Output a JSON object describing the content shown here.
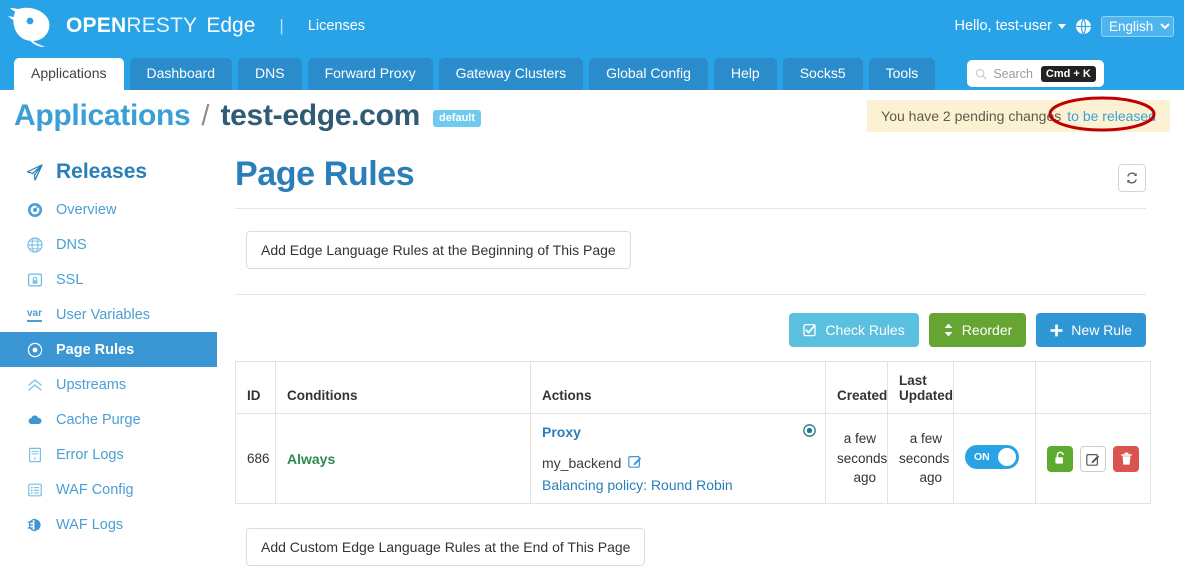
{
  "topbar": {
    "brand_open": "OPEN",
    "brand_resty": "RESTY",
    "brand_product": "Edge",
    "divider": "|",
    "licenses_label": "Licenses",
    "user_greeting": "Hello, test-user",
    "language_selected": "English",
    "language_options": [
      "English"
    ],
    "accent_color": "#29a3e8"
  },
  "nav": {
    "tabs": [
      {
        "label": "Applications",
        "active": true
      },
      {
        "label": "Dashboard",
        "active": false
      },
      {
        "label": "DNS",
        "active": false
      },
      {
        "label": "Forward Proxy",
        "active": false
      },
      {
        "label": "Gateway Clusters",
        "active": false
      },
      {
        "label": "Global Config",
        "active": false
      },
      {
        "label": "Help",
        "active": false
      },
      {
        "label": "Socks5",
        "active": false
      },
      {
        "label": "Tools",
        "active": false
      }
    ],
    "search": {
      "placeholder": "Search",
      "shortcut": "Cmd + K"
    }
  },
  "breadcrumb": {
    "root": "Applications",
    "separator": "/",
    "current": "test-edge.com",
    "badge": "default"
  },
  "pending": {
    "text": "You have 2 pending changes",
    "link_label": "to be released",
    "count": 2,
    "annotation_color": "#c00000",
    "banner_color": "#fcf2d3"
  },
  "sidebar": {
    "title": "Releases",
    "items": [
      {
        "label": "Overview",
        "icon": "gauge-icon",
        "active": false
      },
      {
        "label": "DNS",
        "icon": "globe-icon",
        "active": false
      },
      {
        "label": "SSL",
        "icon": "certificate-lock-icon",
        "active": false
      },
      {
        "label": "User Variables",
        "icon": "var-icon",
        "active": false
      },
      {
        "label": "Page Rules",
        "icon": "target-icon",
        "active": true
      },
      {
        "label": "Upstreams",
        "icon": "chevrons-up-icon",
        "active": false
      },
      {
        "label": "Cache Purge",
        "icon": "cloud-icon",
        "active": false
      },
      {
        "label": "Error Logs",
        "icon": "document-x-icon",
        "active": false
      },
      {
        "label": "WAF Config",
        "icon": "list-icon",
        "active": false
      },
      {
        "label": "WAF Logs",
        "icon": "waf-log-icon",
        "active": false
      }
    ]
  },
  "main": {
    "title": "Page Rules",
    "refresh_icon": "refresh-icon",
    "add_top_label": "Add Edge Language Rules at the Beginning of This Page",
    "add_bottom_label": "Add Custom Edge Language Rules at the End of This Page",
    "actions": {
      "check_rules": "Check Rules",
      "reorder": "Reorder",
      "new_rule": "New Rule",
      "check_color": "#5bc0de",
      "reorder_color": "#67a532",
      "new_color": "#2f97d6"
    },
    "table": {
      "columns": [
        "ID",
        "Conditions",
        "Actions",
        "Created",
        "Last Updated",
        "",
        ""
      ],
      "rows": [
        {
          "id": "686",
          "condition": "Always",
          "action_title": "Proxy",
          "action_backend": "my_backend",
          "action_policy": "Balancing policy: Round Robin",
          "created": "a few seconds ago",
          "updated": "a few seconds ago",
          "enabled_label": "ON",
          "enabled": true,
          "ops": [
            "unlock-icon",
            "edit-icon",
            "trash-icon"
          ]
        }
      ]
    }
  }
}
